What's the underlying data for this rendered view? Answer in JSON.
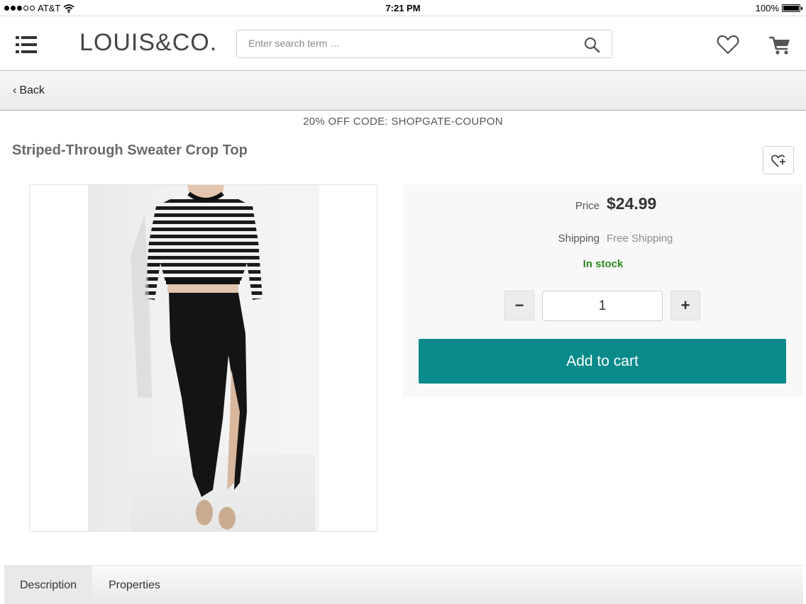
{
  "status_bar": {
    "carrier": "AT&T",
    "time": "7:21 PM",
    "battery": "100%",
    "signal_bars_filled": 3,
    "signal_bars_total": 5
  },
  "header": {
    "logo": "LOUIS&CO.",
    "search_placeholder": "Enter search term …"
  },
  "nav": {
    "back_label": "Back"
  },
  "promo": {
    "coupon_text": "20% OFF CODE: SHOPGATE-COUPON"
  },
  "product": {
    "title": "Striped-Through Sweater Crop Top",
    "price_label": "Price",
    "price": "$24.99",
    "shipping_label": "Shipping",
    "shipping_value": "Free Shipping",
    "stock_status": "In stock",
    "quantity": "1",
    "add_to_cart_label": "Add to cart"
  },
  "tabs": [
    {
      "label": "Description",
      "active": true
    },
    {
      "label": "Properties",
      "active": false
    }
  ],
  "colors": {
    "accent_teal": "#0a8a8a",
    "in_stock_green": "#2b8a1e"
  }
}
